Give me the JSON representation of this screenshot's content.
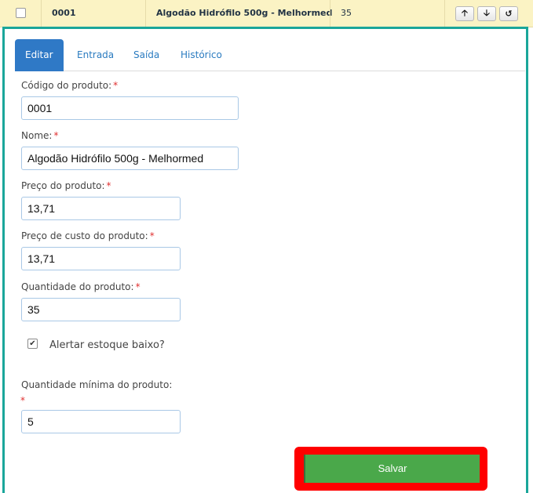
{
  "row": {
    "code": "0001",
    "name": "Algodão Hidrófilo 500g - Melhormed",
    "quantity": "35",
    "up_icon": "arrow-up-icon",
    "down_icon": "arrow-down-icon",
    "reset_icon": "undo-icon"
  },
  "tabs": [
    {
      "label": "Editar",
      "active": true
    },
    {
      "label": "Entrada"
    },
    {
      "label": "Saída"
    },
    {
      "label": "Histórico"
    }
  ],
  "form": {
    "codigo_label": "Código do produto:",
    "codigo_value": "0001",
    "nome_label": "Nome:",
    "nome_value": "Algodão Hidrófilo 500g - Melhormed",
    "preco_label": "Preço do produto:",
    "preco_value": "13,71",
    "custo_label": "Preço de custo do produto:",
    "custo_value": "13,71",
    "qtd_label": "Quantidade do produto:",
    "qtd_value": "35",
    "alerta_label": "Alertar estoque baixo?",
    "alerta_checked": true,
    "min_label": "Quantidade mínima do produto:",
    "min_value": "5",
    "required_mark": "*"
  },
  "save_label": "Salvar",
  "colors": {
    "accent": "#1aa69a",
    "tab_active": "#2f79c6",
    "save": "#4aa84a",
    "highlight": "#ff0000",
    "row_bg": "#fbf3c4"
  }
}
